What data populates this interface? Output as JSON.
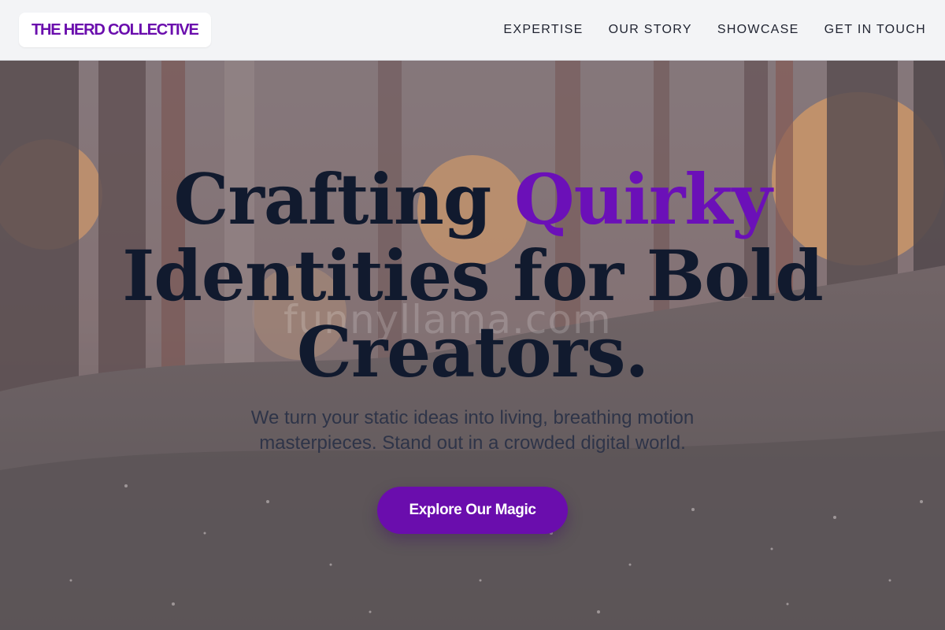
{
  "header": {
    "logo": "THE HERD COLLECTIVE",
    "nav": [
      {
        "label": "EXPERTISE"
      },
      {
        "label": "OUR STORY"
      },
      {
        "label": "SHOWCASE"
      },
      {
        "label": "GET IN TOUCH"
      }
    ]
  },
  "hero": {
    "headline_part1": "Crafting ",
    "headline_accent": "Quirky",
    "headline_part2": "Identities for Bold Creators.",
    "subtitle": "We turn your static ideas into living, breathing motion masterpieces. Stand out in a crowded digital world.",
    "cta_label": "Explore Our Magic",
    "watermark": "funnyllama.com"
  },
  "colors": {
    "brand": "#6a0dad",
    "headline": "#111a2e",
    "header_bg": "#f3f4f6"
  }
}
